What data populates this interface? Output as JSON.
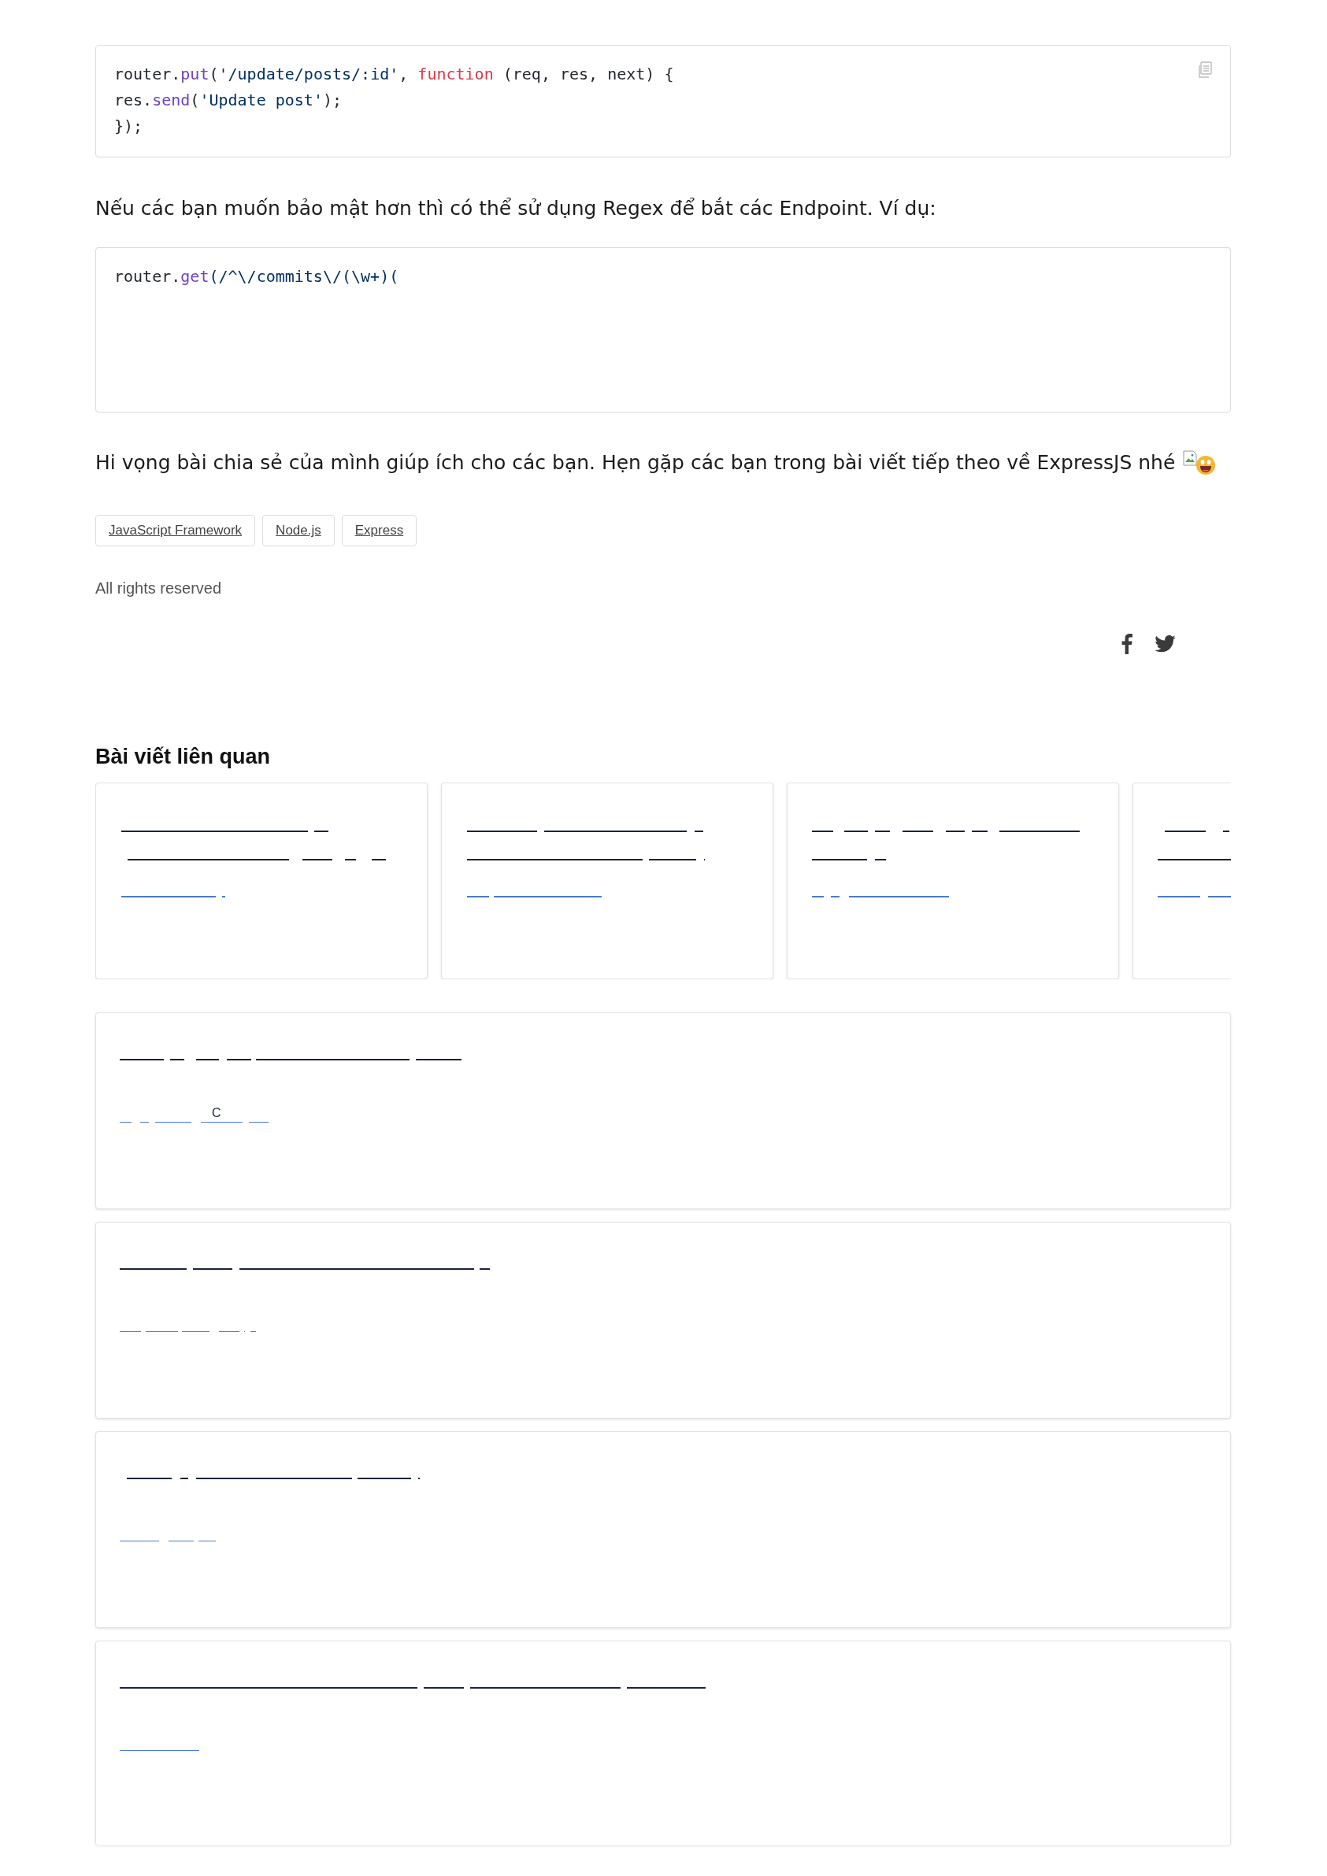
{
  "code_blocks": [
    {
      "copy_button": true,
      "lines": [
        [
          {
            "kind": "plain",
            "text": "router."
          },
          {
            "kind": "method",
            "text": "put"
          },
          {
            "kind": "plain",
            "text": "("
          },
          {
            "kind": "string",
            "text": "'/update/posts/:id'"
          },
          {
            "kind": "plain",
            "text": ", "
          },
          {
            "kind": "keyword",
            "text": "function"
          },
          {
            "kind": "plain",
            "text": " (req, res, next) {"
          }
        ],
        [
          {
            "kind": "plain",
            "text": "res."
          },
          {
            "kind": "method",
            "text": "send"
          },
          {
            "kind": "plain",
            "text": "("
          },
          {
            "kind": "string",
            "text": "'Update post'"
          },
          {
            "kind": "plain",
            "text": ");"
          }
        ],
        [
          {
            "kind": "plain",
            "text": "});"
          }
        ]
      ]
    },
    {
      "copy_button": false,
      "lines": [
        [
          {
            "kind": "plain",
            "text": "router."
          },
          {
            "kind": "method",
            "text": "get"
          },
          {
            "kind": "string",
            "text": "(/^\\/commits\\/(\\w+)("
          }
        ]
      ]
    }
  ],
  "paragraphs": [
    "Nếu các bạn muốn bảo mật hơn thì có thể sử dụng Regex để bắt các Endpoint. Ví dụ:",
    "Hi vọng bài chia sẻ của mình giúp ích cho các bạn. Hẹn gặp các bạn trong bài viết tiếp theo về ExpressJS nhé"
  ],
  "tags": [
    "JavaScript Framework",
    "Node.js",
    "Express"
  ],
  "license": "All rights reserved",
  "share": [
    {
      "kind": "facebook"
    },
    {
      "kind": "twitter"
    }
  ],
  "related": {
    "title": "Bài viết liên quan",
    "cards": [
      {
        "kind": "placeholder"
      },
      {
        "kind": "placeholder"
      },
      {
        "kind": "placeholder"
      },
      {
        "kind": "placeholder"
      }
    ]
  },
  "posts": [
    {
      "kind": "placeholder",
      "fragment": "C"
    },
    {
      "kind": "placeholder"
    },
    {
      "kind": "placeholder"
    },
    {
      "kind": "placeholder"
    }
  ]
}
